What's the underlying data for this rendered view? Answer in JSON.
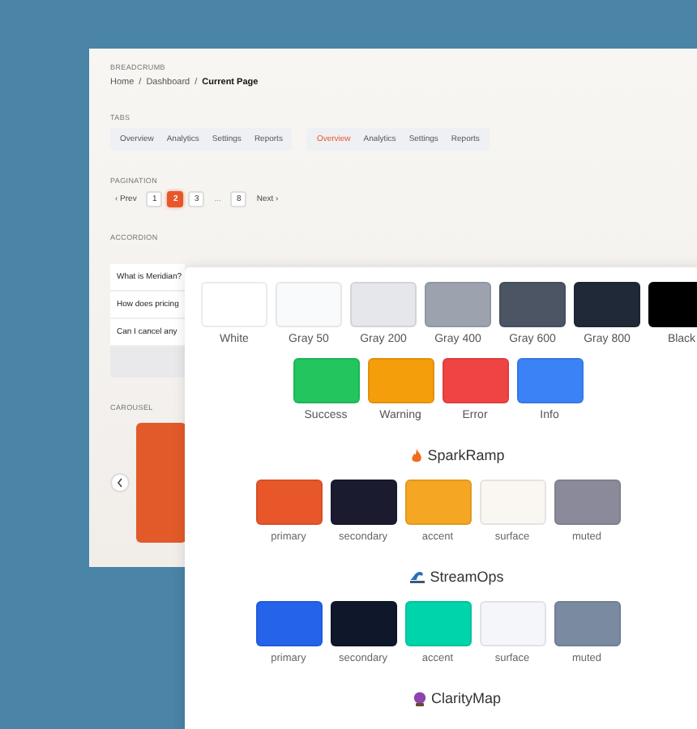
{
  "back_panel": {
    "breadcrumb": {
      "label": "BREADCRUMB",
      "separator": "/",
      "items": [
        {
          "text": "Home",
          "current": false
        },
        {
          "text": "Dashboard",
          "current": false
        },
        {
          "text": "Current Page",
          "current": true
        }
      ]
    },
    "tabs": {
      "label": "TABS",
      "groups": [
        [
          {
            "label": "Overview",
            "selected": false
          },
          {
            "label": "Analytics",
            "selected": false
          },
          {
            "label": "Settings",
            "selected": false
          },
          {
            "label": "Reports",
            "selected": false
          }
        ],
        [
          {
            "label": "Overview",
            "selected": true
          },
          {
            "label": "Analytics",
            "selected": false
          },
          {
            "label": "Settings",
            "selected": false
          },
          {
            "label": "Reports",
            "selected": false
          }
        ]
      ]
    },
    "pagination": {
      "label": "PAGINATION",
      "prev": "‹ Prev",
      "next": "Next ›",
      "pages": [
        {
          "label": "1",
          "kind": "page",
          "selected": false
        },
        {
          "label": "2",
          "kind": "page",
          "selected": true
        },
        {
          "label": "3",
          "kind": "page",
          "selected": false
        },
        {
          "label": "...",
          "kind": "ellipsis"
        },
        {
          "label": "8",
          "kind": "page",
          "selected": false
        }
      ]
    },
    "accordion": {
      "label": "ACCORDION",
      "items": [
        "What is Meridian?",
        "How does pricing",
        "Can I cancel any"
      ]
    },
    "carousel": {
      "label": "CAROUSEL"
    }
  },
  "palette": {
    "base_colors": [
      {
        "name": "White",
        "color": "#ffffff"
      },
      {
        "name": "Gray 50",
        "color": "#f9fafb"
      },
      {
        "name": "Gray 200",
        "color": "#e5e7eb"
      },
      {
        "name": "Gray 400",
        "color": "#9ca3af"
      },
      {
        "name": "Gray 600",
        "color": "#4b5563"
      },
      {
        "name": "Gray 800",
        "color": "#1f2937"
      },
      {
        "name": "Black",
        "color": "#000000"
      }
    ],
    "status_colors": [
      {
        "name": "Success",
        "color": "#22c55e"
      },
      {
        "name": "Warning",
        "color": "#f59e0b"
      },
      {
        "name": "Error",
        "color": "#ef4444"
      },
      {
        "name": "Info",
        "color": "#3b82f6"
      }
    ],
    "themes": [
      {
        "name": "SparkRamp",
        "swatches": [
          {
            "name": "primary",
            "color": "#e8572a"
          },
          {
            "name": "secondary",
            "color": "#1a1b2e"
          },
          {
            "name": "accent",
            "color": "#f5a623"
          },
          {
            "name": "surface",
            "color": "#faf7f2"
          },
          {
            "name": "muted",
            "color": "#8a8a9a"
          }
        ]
      },
      {
        "name": "StreamOps",
        "swatches": [
          {
            "name": "primary",
            "color": "#2563eb"
          },
          {
            "name": "secondary",
            "color": "#0f172a"
          },
          {
            "name": "accent",
            "color": "#00d4aa"
          },
          {
            "name": "surface",
            "color": "#f4f6f9"
          },
          {
            "name": "muted",
            "color": "#7a8aa0"
          }
        ]
      },
      {
        "name": "ClarityMap"
      }
    ]
  }
}
